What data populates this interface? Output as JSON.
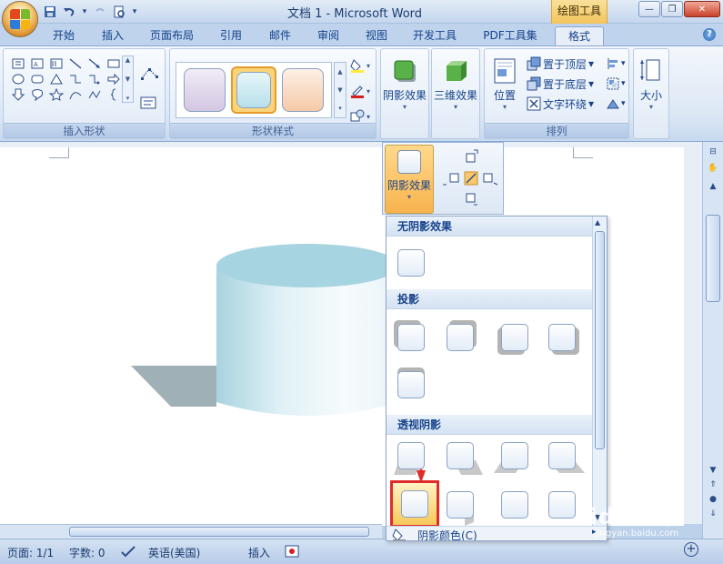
{
  "titlebar": {
    "title": "文档 1 - Microsoft Word",
    "contextual_tab": "绘图工具"
  },
  "tabs": [
    {
      "label": "开始"
    },
    {
      "label": "插入"
    },
    {
      "label": "页面布局"
    },
    {
      "label": "引用"
    },
    {
      "label": "邮件"
    },
    {
      "label": "审阅"
    },
    {
      "label": "视图"
    },
    {
      "label": "开发工具"
    },
    {
      "label": "PDF工具集"
    },
    {
      "label": "格式",
      "active": true
    }
  ],
  "ribbon": {
    "groups": {
      "insert_shapes": "插入形状",
      "shape_styles": "形状样式",
      "arrange": "排列"
    },
    "shadow_effect": "阴影效果",
    "three_d_effect": "三维效果",
    "position": "位置",
    "bring_to_front": "置于顶层",
    "send_to_back": "置于底层",
    "text_wrap": "文字环绕",
    "size": "大小"
  },
  "dropdown": {
    "button_label": "阴影效果",
    "sections": {
      "no_shadow": "无阴影效果",
      "drop_shadow": "投影",
      "perspective_shadow": "透视阴影"
    },
    "shadow_color": "阴影颜色(C)"
  },
  "statusbar": {
    "page": "页面: 1/1",
    "words": "字数: 0",
    "language": "英语(美国)",
    "mode": "插入"
  },
  "watermark": {
    "brand": "Baidu 经验",
    "url": "jingyan.baidu.com"
  },
  "colors": {
    "accent": "#f7b84b",
    "highlight": "#e02b2b",
    "cylinder": "#b8dde8",
    "shadow": "#9fb0b7"
  }
}
